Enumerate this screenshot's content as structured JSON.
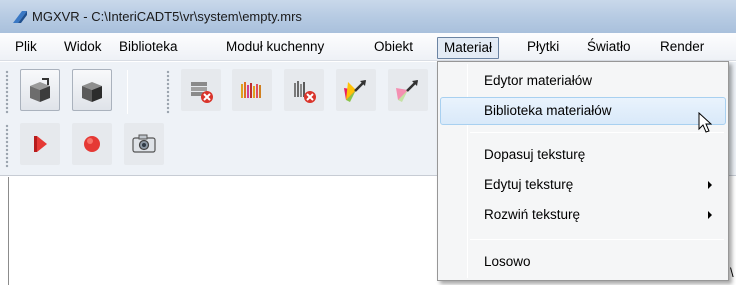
{
  "window": {
    "title": "MGXVR - C:\\InteriCADT5\\vr\\system\\empty.mrs"
  },
  "menubar": {
    "items": [
      {
        "label": "Plik"
      },
      {
        "label": "Widok"
      },
      {
        "label": "Biblioteka"
      },
      {
        "label": "Moduł kuchenny"
      },
      {
        "label": "Obiekt"
      },
      {
        "label": "Materiał",
        "active": true
      },
      {
        "label": "Płytki"
      },
      {
        "label": "Światło"
      },
      {
        "label": "Render"
      }
    ]
  },
  "material_menu": {
    "items": [
      {
        "label": "Edytor materiałów"
      },
      {
        "label": "Biblioteka materiałów",
        "hovered": true
      },
      {
        "label": "Dopasuj teksturę"
      },
      {
        "label": "Edytuj teksturę",
        "submenu": true
      },
      {
        "label": "Rozwiń teksturę",
        "submenu": true
      },
      {
        "label": "Losowo"
      }
    ]
  },
  "toolbar": {
    "row1_icons": [
      "export-box-icon",
      "solid-box-icon",
      "brick-delete-icon",
      "color-stripes-icon",
      "stripes-delete-icon",
      "palette-arrow-icon",
      "palette-arrow-2-icon"
    ],
    "row2_icons": [
      "play-icon",
      "record-icon",
      "camera-icon"
    ]
  },
  "colors": {
    "menu_active_border": "#6b84a3",
    "hover_border": "#a8d0f0",
    "title_bar": "#b7cbe3"
  },
  "stray_glyph": "\\"
}
